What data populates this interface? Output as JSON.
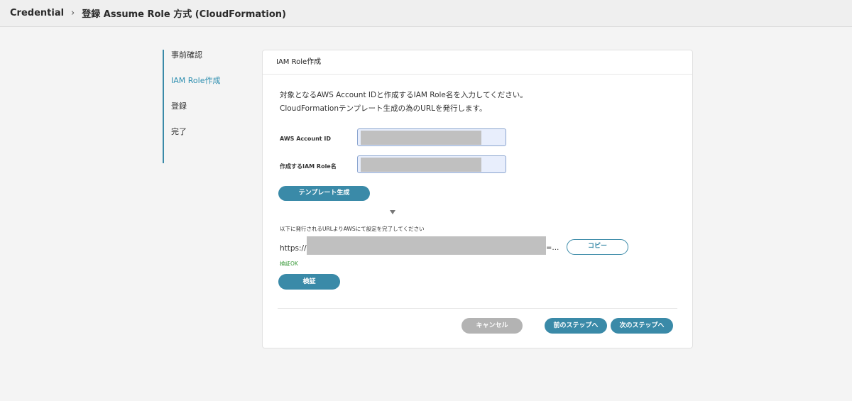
{
  "breadcrumb": {
    "root": "Credential",
    "separator": "›",
    "current": "登録 Assume Role 方式 (CloudFormation)"
  },
  "steps": [
    {
      "label": "事前確認",
      "active": false
    },
    {
      "label": "IAM Role作成",
      "active": true
    },
    {
      "label": "登録",
      "active": false
    },
    {
      "label": "完了",
      "active": false
    }
  ],
  "card": {
    "title": "IAM Role作成",
    "description_line1": "対象となるAWS Account IDと作成するIAM Role名を入力してください。",
    "description_line2": "CloudFormationテンプレート生成の為のURLを発行します。",
    "fields": {
      "account_id_label": "AWS Account ID",
      "role_name_label": "作成するIAM Role名"
    },
    "generate_button": "テンプレート生成",
    "instruction": "以下に発行されるURLよりAWSにて設定を完了してください",
    "url_prefix": "https://a",
    "url_suffix": "=…",
    "copy_button": "コピー",
    "verify_status": "検証OK",
    "verify_button": "検証"
  },
  "footer": {
    "cancel_button": "キャンセル",
    "prev_button": "前のステップへ",
    "next_button": "次のステップへ"
  },
  "colors": {
    "accent": "#3a8aa8",
    "success": "#3a9a3a",
    "disabled": "#b3b3b3"
  }
}
